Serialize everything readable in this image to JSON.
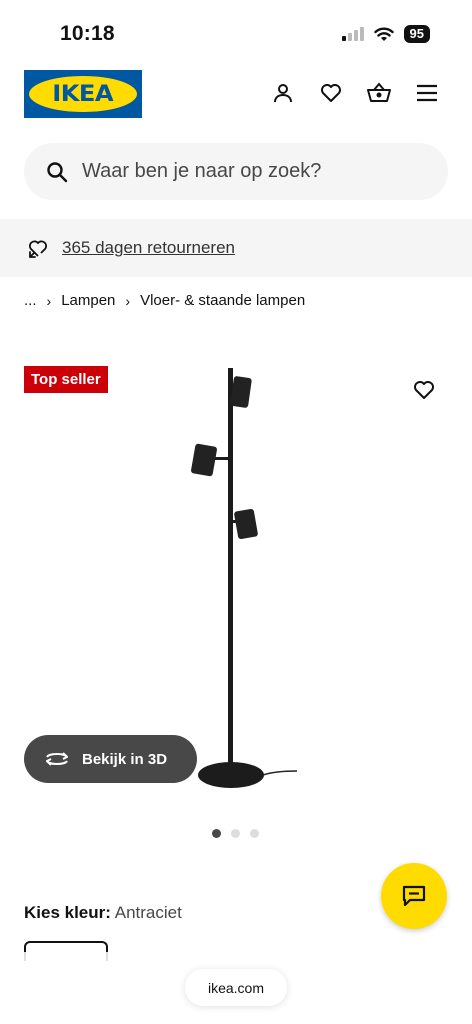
{
  "status_bar": {
    "time": "10:18",
    "battery": "95"
  },
  "header": {
    "logo_text": "IKEA"
  },
  "search": {
    "placeholder": "Waar ben je naar op zoek?"
  },
  "returns_banner": {
    "text": "365 dagen retourneren"
  },
  "breadcrumb": {
    "ellipsis": "...",
    "items": [
      "Lampen",
      "Vloer- & staande lampen"
    ]
  },
  "product": {
    "badge": "Top seller",
    "view_3d_label": "Bekijk in 3D",
    "image_count": 3,
    "active_image": 1
  },
  "color_selector": {
    "label": "Kies kleur:",
    "value": "Antraciet"
  },
  "browser": {
    "url": "ikea.com"
  },
  "colors": {
    "brand_blue": "#0058a3",
    "brand_yellow": "#ffdb00",
    "badge_red": "#cc0008",
    "dark_grey": "#484848"
  }
}
